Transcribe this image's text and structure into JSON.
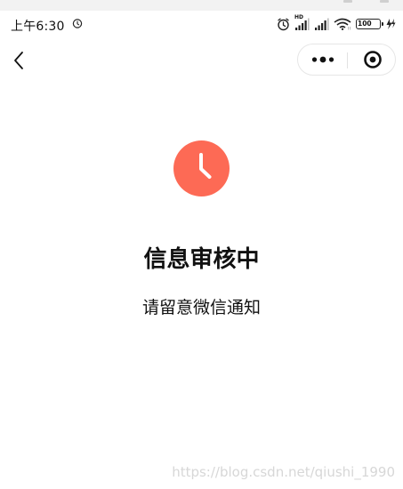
{
  "status_bar": {
    "time": "上午6:30",
    "battery_level": "100",
    "hd_label": "HD",
    "battery_color": "#4caf1e"
  },
  "nav": {
    "back_icon": "chevron-left-icon",
    "more_icon": "more-dots-icon",
    "close_icon": "target-circle-icon"
  },
  "main": {
    "status_icon": "clock-icon",
    "status_icon_color": "#fd6a55",
    "title": "信息审核中",
    "subtitle": "请留意微信通知"
  },
  "watermark": "https://blog.csdn.net/qiushi_1990"
}
